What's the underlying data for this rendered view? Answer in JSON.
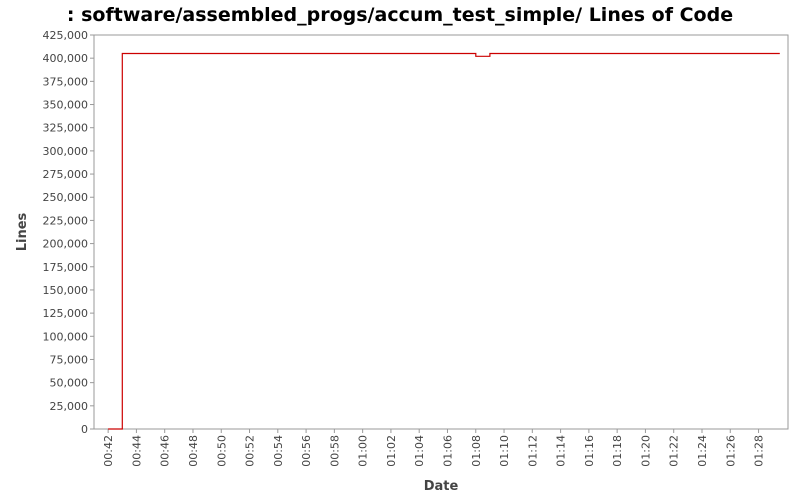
{
  "chart_data": {
    "type": "line",
    "title": ": software/assembled_progs/accum_test_simple/ Lines of Code",
    "xlabel": "Date",
    "ylabel": "Lines",
    "x_tick_labels": [
      "00:42",
      "00:44",
      "00:46",
      "00:48",
      "00:50",
      "00:52",
      "00:54",
      "00:56",
      "00:58",
      "01:00",
      "01:02",
      "01:04",
      "01:06",
      "01:08",
      "01:10",
      "01:12",
      "01:14",
      "01:16",
      "01:18",
      "01:20",
      "01:22",
      "01:24",
      "01:26",
      "01:28"
    ],
    "y_ticks": [
      0,
      25000,
      50000,
      75000,
      100000,
      125000,
      150000,
      175000,
      200000,
      225000,
      250000,
      275000,
      300000,
      325000,
      350000,
      375000,
      400000,
      425000
    ],
    "y_tick_labels": [
      "0",
      "25,000",
      "50,000",
      "75,000",
      "100,000",
      "125,000",
      "150,000",
      "175,000",
      "200,000",
      "225,000",
      "250,000",
      "275,000",
      "300,000",
      "325,000",
      "350,000",
      "375,000",
      "400,000",
      "425,000"
    ],
    "xlim": [
      "00:41:00",
      "01:30:05"
    ],
    "ylim": [
      0,
      425000
    ],
    "grid": false,
    "legend": "none",
    "series": [
      {
        "color": "#cc0000",
        "step": true,
        "points": [
          [
            "00:42:00",
            0
          ],
          [
            "00:43:00",
            405000
          ],
          [
            "01:08:00",
            402000
          ],
          [
            "01:09:00",
            405000
          ],
          [
            "01:29:30",
            405000
          ]
        ]
      }
    ]
  }
}
